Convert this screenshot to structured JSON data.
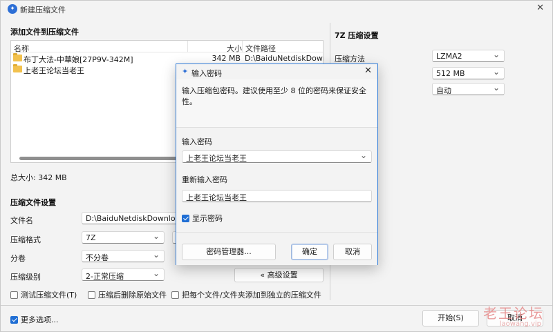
{
  "window": {
    "title": "新建压缩文件",
    "close_glyph": "✕"
  },
  "files_section": {
    "title": "添加文件到压缩文件",
    "columns": {
      "name": "名称",
      "size": "大小",
      "path": "文件路径"
    },
    "rows": [
      {
        "name": "布丁大法-中華娘[27P9V-342M]",
        "size": "342 MB",
        "path": "D:\\BaiduNetdiskDownload\\"
      },
      {
        "name": "上老王论坛当老王",
        "size": "",
        "path": ""
      }
    ],
    "total": "总大小: 342 MB"
  },
  "settings": {
    "title": "压缩文件设置",
    "filename_label": "文件名",
    "filename_value": "D:\\BaiduNetdiskDownload\\BD",
    "format_label": "压缩格式",
    "format_value": "7Z",
    "split_label": "分卷",
    "split_value": "不分卷",
    "level_label": "压缩级别",
    "level_value": "2-正常压缩",
    "advanced_button": "« 高级设置",
    "test_label": "测试压缩文件(T)",
    "delete_label": "压缩后删除原始文件",
    "separate_label": "把每个文件/文件夹添加到独立的压缩文件",
    "more_options_label": "更多选项..."
  },
  "sz_settings": {
    "title": "7Z 压缩设置",
    "method_label": "压缩方法",
    "method_value": "LZMA2",
    "dict_value": "512 MB",
    "word_value": "自动"
  },
  "buttons": {
    "start": "开始(S)",
    "cancel": "取消"
  },
  "dialog": {
    "title": "输入密码",
    "icon_glyph": "✦",
    "close_glyph": "✕",
    "description": "输入压缩包密码。建议使用至少 8 位的密码来保证安全性。",
    "password_label": "输入密码",
    "password_value": "上老王论坛当老王",
    "repeat_label": "重新输入密码",
    "repeat_value": "上老王论坛当老王",
    "show_password_label": "显示密码",
    "show_password_checked": true,
    "manager_button": "密码管理器...",
    "ok_button": "确定",
    "cancel_button": "取消"
  },
  "watermark": {
    "text": "老王论坛",
    "url": "laowang.vip"
  }
}
